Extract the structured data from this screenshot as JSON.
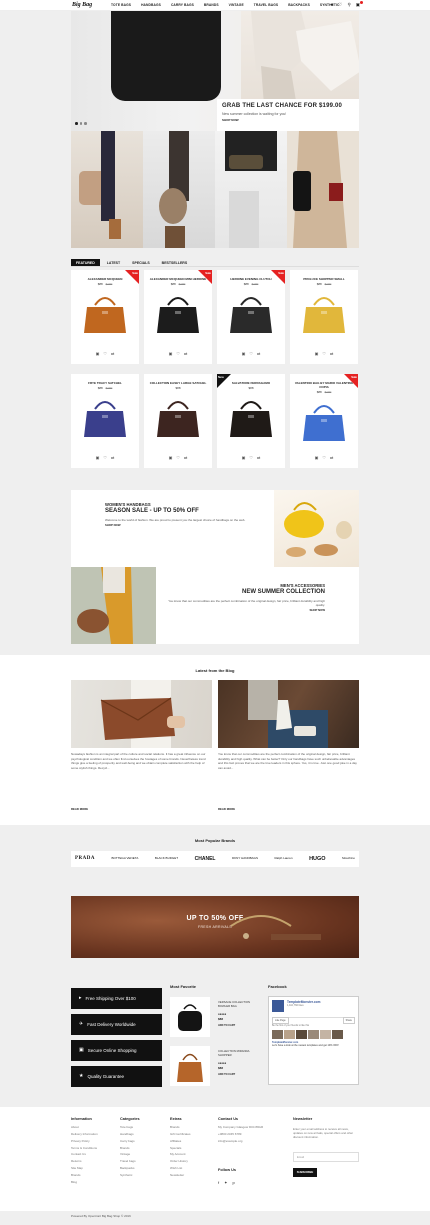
{
  "header": {
    "logo": "Big Bag",
    "nav": [
      "TOTE BAGS",
      "HANDBAGS",
      "CARRY BAGS",
      "BRANDS",
      "VINTAGE",
      "TRAVEL BAGS",
      "BACKPACKS",
      "SYNTHETIC"
    ],
    "icons": [
      "user-icon",
      "heart-icon",
      "search-icon",
      "cart-icon"
    ]
  },
  "hero": {
    "title": "GRAB THE LAST CHANCE FOR $199.00",
    "subtitle": "New summer collection is waiting for you!",
    "cta": "SHOP NOW"
  },
  "tabs": [
    "FEATURED",
    "LATEST",
    "SPECIALS",
    "BESTSELLERS"
  ],
  "products": [
    {
      "name": "ALEXANDER MCQUEEN",
      "price": "$88",
      "old": "$100",
      "badge": "Sale",
      "color": "#c0671f"
    },
    {
      "name": "ALEXANDER MCQUEEN MINI HEROINE",
      "price": "$88",
      "old": "$100",
      "badge": "Sale",
      "color": "#1c1c1c"
    },
    {
      "name": "HEROINE EVENING CLUTCH",
      "price": "$88",
      "old": "$100",
      "badge": "Sale",
      "color": "#2a2a2a"
    },
    {
      "name": "PROLUCE SHOPPER SMALL",
      "price": "$88",
      "old": "$100",
      "badge": "",
      "color": "#e1b73b"
    },
    {
      "name": "FRYE TRACY SATCHEL",
      "price": "$88",
      "old": "$100",
      "badge": "",
      "color": "#3a3f8c"
    },
    {
      "name": "COLLECTION EASEY LARGE SATCHEL",
      "price": "$88",
      "old": "",
      "badge": "",
      "color": "#3d2520"
    },
    {
      "name": "SALVATORE FERRAGAMO",
      "price": "$88",
      "old": "",
      "badge": "New",
      "color": "#1f1a17"
    },
    {
      "name": "VALENTINO BAG BY MARIO VALENTINO COPIA",
      "price": "$88",
      "old": "$100",
      "badge": "Sale",
      "color": "#3f6fd0"
    }
  ],
  "product_actions": [
    "cart-icon",
    "heart-icon",
    "compare-icon"
  ],
  "promo1": {
    "kicker": "WOMEN'S HANDBAGS",
    "title": "SEASON SALE - UP TO 50% OFF",
    "text": "Welcome to the world of fashion. We are proud to present you the largest choice of handbags on the web.",
    "link": "SHOP NOW"
  },
  "promo2": {
    "kicker": "MEN'S ACCESSORIES",
    "title": "NEW SUMMER COLLECTION",
    "text": "You know that our commodities are the perfect combination of the original design, fair price, brilliant durability and high quality.",
    "link": "SHOP NOW"
  },
  "blog": {
    "title": "Latest from the Blog",
    "posts": [
      {
        "text": "Nowadays fashion is an integral part of the culture and social relations. It has a great influence on our psychological condition and we often find ourselves the hostages of some brands. Nevertheless trend things give a feeling of prosperity and well-being and we obtain complete satisfaction with the help of some stylish things. Recycl...",
        "more": "READ MORE"
      },
      {
        "text": "You know that our commodities are the perfect combination of the original design, fair price, brilliant durability and high quality. What can be better? Only our handbags have such unbelievable advantages and this fact proves that we are the true leaders in this sphere. Yes, it is true. Just one good joke in a day can avoid...",
        "more": "READ MORE"
      }
    ]
  },
  "brands": {
    "title": "Most Popular Brands",
    "items": [
      "PRADA",
      "BOTTEGA VENETA",
      "BLACK BUDGET",
      "CHANEL",
      "DKNY HANDBAGS",
      "Ralph Lauren",
      "HUGO",
      "Moschino"
    ]
  },
  "banner": {
    "title": "UP TO 50% OFF",
    "subtitle": "FRESH ARRIVALS"
  },
  "features": [
    "Free Shipping Over $100",
    "Fast Delivery Worldwide",
    "Secure Online Shopping",
    "Quality Guarantee"
  ],
  "most_favorite": {
    "title": "Most Favorite",
    "items": [
      {
        "name": "VERSACE COLLECTION BOWLER BAG",
        "stars": "●●●●●",
        "price": "$88",
        "action": "ADD TO CART"
      },
      {
        "name": "COLLECTION MIRANDA SHOPPER",
        "stars": "●●●●●",
        "price": "$88",
        "action": "ADD TO CART"
      }
    ]
  },
  "facebook": {
    "title": "Facebook",
    "page": "TemplateMonster.com",
    "likes": "1,110,766 likes",
    "like_btn": "Like Page",
    "share_btn": "Share",
    "friends": "Be the first of your friends to like this",
    "post_name": "TemplateMonster.com",
    "post_text": "Let's have a look at the newest templates and get 10% OFF!"
  },
  "footer": {
    "cols": [
      {
        "h": "Information",
        "items": [
          "About",
          "Delivery Information",
          "Privacy Policy",
          "Terms & Conditions",
          "Contact Us",
          "Returns",
          "Site Map",
          "Brands",
          "Blog"
        ]
      },
      {
        "h": "Categories",
        "items": [
          "Tote bags",
          "Handbags",
          "Carry bags",
          "Brands",
          "Vintage",
          "Travel bags",
          "Backpacks",
          "Synthetic"
        ]
      },
      {
        "h": "Extras",
        "items": [
          "Brands",
          "Gift Certificates",
          "Affiliates",
          "Specials",
          "My Account",
          "Order History",
          "Wish List",
          "Newsletter"
        ]
      },
      {
        "h": "Contact Us",
        "items": [
          "My Company Glasgow D04 89GR",
          "+0800 2345 6789",
          "info@example.org"
        ]
      }
    ],
    "follow": "Follow Us",
    "newsletter_title": "Newsletter",
    "newsletter_text": "Enter your email address to receive all news, updates on new arrivals, special offers and other discount information.",
    "newsletter_placeholder": "Email",
    "subscribe": "SUBSCRIBE",
    "copyright": "Powered By OpenCart Big Bag Shop © 2016"
  }
}
